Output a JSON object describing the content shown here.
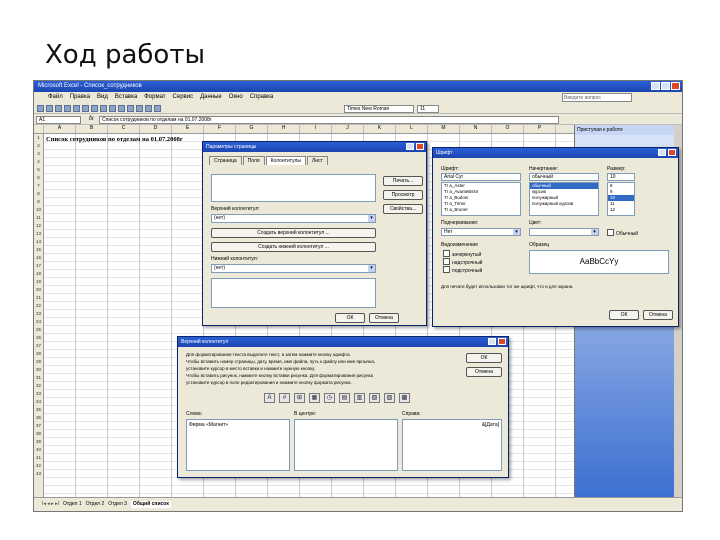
{
  "slide": {
    "title": "Ход работы"
  },
  "excel": {
    "window_title": "Microsoft Excel - Список_сотрудников",
    "menu": [
      "Файл",
      "Правка",
      "Вид",
      "Вставка",
      "Формат",
      "Сервис",
      "Данные",
      "Окно",
      "Справка"
    ],
    "help_placeholder": "Введите вопрос",
    "font_name": "Times New Roman",
    "font_size": "11",
    "name_box": "A1",
    "fx_label": "fx",
    "formula": "Список сотрудников по отделам на 01.07.2008г",
    "columns": [
      "A",
      "B",
      "C",
      "D",
      "E",
      "F",
      "G",
      "H",
      "I",
      "J",
      "K",
      "L",
      "M",
      "N",
      "O",
      "P"
    ],
    "rows": [
      "1",
      "2",
      "3",
      "4",
      "5",
      "6",
      "7",
      "8",
      "9",
      "10",
      "11",
      "12",
      "13",
      "14",
      "15",
      "16",
      "17",
      "18",
      "19",
      "20",
      "21",
      "22",
      "23",
      "24",
      "25",
      "26",
      "27",
      "28",
      "29",
      "30",
      "31",
      "32",
      "33",
      "34",
      "35",
      "36",
      "37",
      "38",
      "39",
      "40",
      "41",
      "42",
      "43"
    ],
    "cell_a1": "Список сотрудников по отделам на 01.07.2008г",
    "task_pane_title": "Приступая к работе",
    "sheet_nav": "I◂ ◂ ▸ ▸I",
    "sheets": [
      "Отдел 1",
      "Отдел 2",
      "Отдел 3"
    ],
    "active_sheet": "Общий список"
  },
  "page_setup": {
    "title": "Параметры страницы",
    "tabs": [
      "Страница",
      "Поля",
      "Колонтитулы",
      "Лист"
    ],
    "active_tab": "Колонтитулы",
    "print_btn": "Печать...",
    "preview_btn": "Просмотр",
    "options_btn": "Свойства...",
    "header_label": "Верхний колонтитул:",
    "header_value": "(нет)",
    "create_header_btn": "Создать верхний колонтитул ...",
    "create_footer_btn": "Создать нижний колонтитул ...",
    "footer_label": "Нижний колонтитул:",
    "footer_value": "(нет)",
    "ok": "ОК",
    "cancel": "Отмена"
  },
  "font_dialog": {
    "title": "Шрифт",
    "font_label": "Шрифт:",
    "font_value": "Arial Cyr",
    "fonts": [
      "Tr a_Aster",
      "Tr a_AvanteBsNr",
      "Tr a_Bodoni",
      "Tr a_Timer",
      "Tr a_Bruner"
    ],
    "style_label": "Начертание:",
    "style_value": "обычный",
    "styles": [
      "обычный",
      "курсив",
      "полужирный",
      "полужирный курсив"
    ],
    "size_label": "Размер:",
    "size_value": "10",
    "sizes": [
      "8",
      "9",
      "10",
      "11",
      "12"
    ],
    "underline_label": "Подчеркивание:",
    "underline_value": "Нет",
    "color_label": "Цвет:",
    "effects_label": "Видоизменение",
    "effects": [
      "зачеркнутый",
      "надстрочный",
      "подстрочный"
    ],
    "sample_label": "Образец",
    "sample_text": "AaBbCcYy",
    "note": "Для печати будет использован тот же шрифт, что и для экрана.",
    "normal_font": "Обычный",
    "ok": "ОК",
    "cancel": "Отмена"
  },
  "header_dialog": {
    "title": "Верхний колонтитул",
    "instructions": [
      "Для форматирования текста выделите текст, а затем нажмите кнопку шрифта.",
      "Чтобы вставить номер страницы, дату, время, имя файла, путь к файлу или имя ярлычка,",
      "установите курсор в место вставки и нажмите нужную кнопку.",
      "Чтобы вставить рисунок, нажмите кнопку вставки рисунка. Для форматирования рисунка",
      "установите курсор в поле редактирования и нажмите кнопку формата рисунка."
    ],
    "ok": "ОК",
    "cancel": "Отмена",
    "icons": [
      "A",
      "#",
      "⊞",
      "▦",
      "◷",
      "▤",
      "▥",
      "▧",
      "▨",
      "▩"
    ],
    "left_label": "Слева:",
    "left_value": "Фирма «Магнит»",
    "center_label": "В центре:",
    "center_value": "",
    "right_label": "Справа:",
    "right_value": "&[Дата]"
  }
}
